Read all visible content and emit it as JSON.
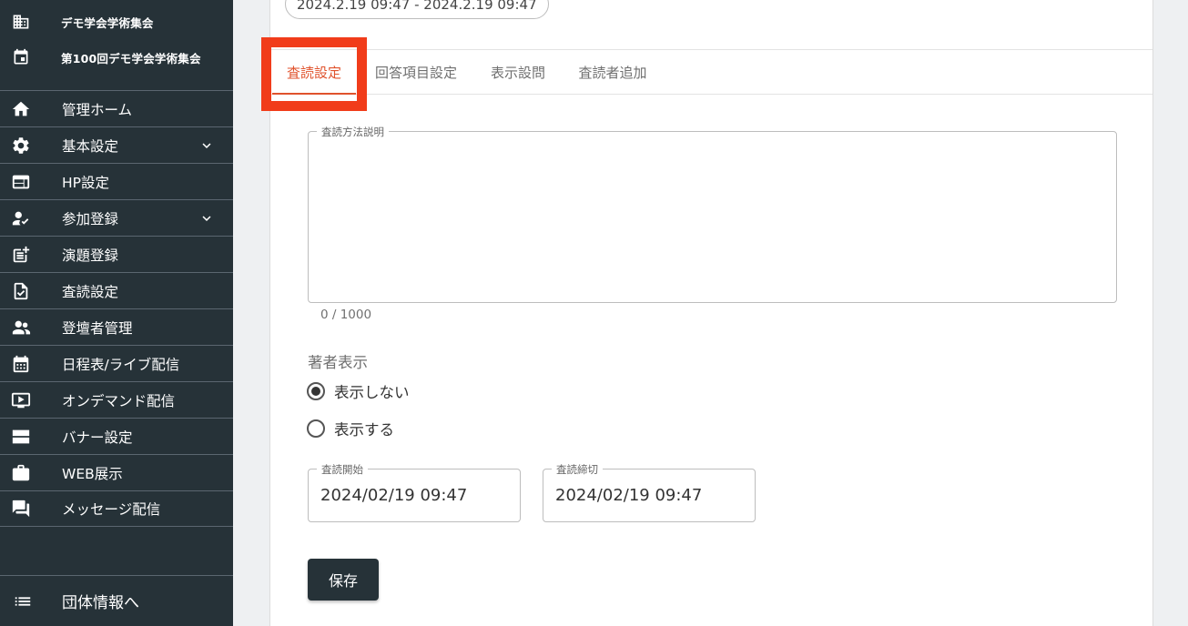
{
  "sidebar": {
    "org_name": "デモ学会学術集会",
    "event_name": "第100回デモ学会学術集会",
    "items": [
      {
        "label": "管理ホーム",
        "icon": "home-icon",
        "expandable": false
      },
      {
        "label": "基本設定",
        "icon": "gear-icon",
        "expandable": true
      },
      {
        "label": "HP設定",
        "icon": "web-window-icon",
        "expandable": false
      },
      {
        "label": "参加登録",
        "icon": "person-check-icon",
        "expandable": true
      },
      {
        "label": "演題登録",
        "icon": "post-add-icon",
        "expandable": false
      },
      {
        "label": "査読設定",
        "icon": "document-check-icon",
        "expandable": false
      },
      {
        "label": "登壇者管理",
        "icon": "speaker-group-icon",
        "expandable": false
      },
      {
        "label": "日程表/ライブ配信",
        "icon": "calendar-icon",
        "expandable": false
      },
      {
        "label": "オンデマンド配信",
        "icon": "monitor-play-icon",
        "expandable": false
      },
      {
        "label": "バナー設定",
        "icon": "banner-icon",
        "expandable": false
      },
      {
        "label": "WEB展示",
        "icon": "briefcase-icon",
        "expandable": false
      },
      {
        "label": "メッセージ配信",
        "icon": "chat-icon",
        "expandable": false
      }
    ],
    "bottom_item": {
      "label": "団体情報へ",
      "icon": "list-icon"
    }
  },
  "main": {
    "date_range": "2024.2.19 09:47 - 2024.2.19 09:47",
    "tabs": [
      {
        "label": "査読設定",
        "active": true
      },
      {
        "label": "回答項目設定",
        "active": false
      },
      {
        "label": "表示設問",
        "active": false
      },
      {
        "label": "査読者追加",
        "active": false
      }
    ],
    "description": {
      "label": "査読方法説明",
      "value": "",
      "counter": "0 / 1000"
    },
    "author_display": {
      "title": "著者表示",
      "options": [
        {
          "label": "表示しない",
          "checked": true
        },
        {
          "label": "表示する",
          "checked": false
        }
      ]
    },
    "review_start": {
      "label": "査読開始",
      "value": "2024/02/19 09:47"
    },
    "review_end": {
      "label": "査読締切",
      "value": "2024/02/19 09:47"
    },
    "save_label": "保存"
  },
  "colors": {
    "sidebar_bg": "#263238",
    "accent": "#e0522c",
    "highlight": "#f13c1a"
  }
}
